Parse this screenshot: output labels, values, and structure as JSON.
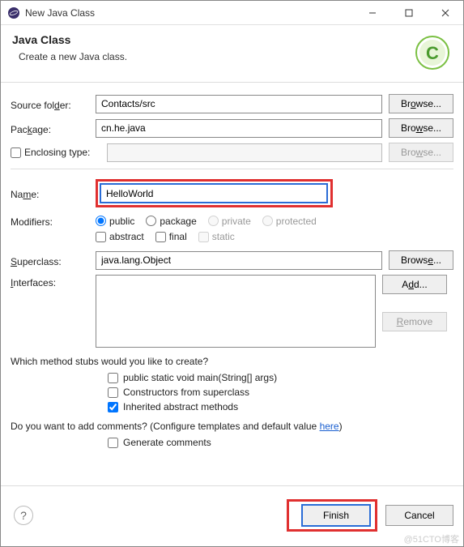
{
  "titlebar": {
    "title": "New Java Class"
  },
  "header": {
    "title": "Java Class",
    "subtitle": "Create a new Java class."
  },
  "form": {
    "sourceFolder": {
      "label": "Source folder:",
      "mn": "d",
      "value": "Contacts/src",
      "browse": "Browse...",
      "browseMn": "o"
    },
    "package": {
      "label": "Package:",
      "mn": "k",
      "value": "cn.he.java",
      "browse": "Browse...",
      "browseMn": "w"
    },
    "enclosing": {
      "label": "Enclosing type:",
      "mn": "",
      "value": "",
      "browse": "Browse...",
      "browseMn": "w"
    },
    "name": {
      "label": "Name:",
      "mn": "m",
      "value": "HelloWorld"
    },
    "modifiers": {
      "label": "Modifiers:",
      "public": "public",
      "publicMn": "p",
      "package": "package",
      "packageMn": "c",
      "private": "private",
      "privateMn": "v",
      "protected": "protected",
      "protectedMn": "t",
      "abstract": "abstract",
      "abstractMn": "a",
      "final": "final",
      "finalMn": "l",
      "static": "static"
    },
    "superclass": {
      "label": "Superclass:",
      "mn": "S",
      "value": "java.lang.Object",
      "browse": "Browse...",
      "browseMn": "e"
    },
    "interfaces": {
      "label": "Interfaces:",
      "mn": "I",
      "add": "Add...",
      "addMn": "d",
      "remove": "Remove",
      "removeMn": "R"
    }
  },
  "stubs": {
    "question": "Which method stubs would you like to create?",
    "main": "public static void main(String[] args)",
    "constructors": "Constructors from superclass",
    "inherited": "Inherited abstract methods",
    "constructorsMn": "u",
    "inheritedMn": "h"
  },
  "comments": {
    "question_pre": "Do you want to add comments? (Configure templates and default value ",
    "link": "here",
    "question_post": ")",
    "generate": "Generate comments",
    "generateMn": "G"
  },
  "footer": {
    "finish": "Finish",
    "finishMn": "F",
    "cancel": "Cancel"
  },
  "watermark": "@51CTO博客"
}
